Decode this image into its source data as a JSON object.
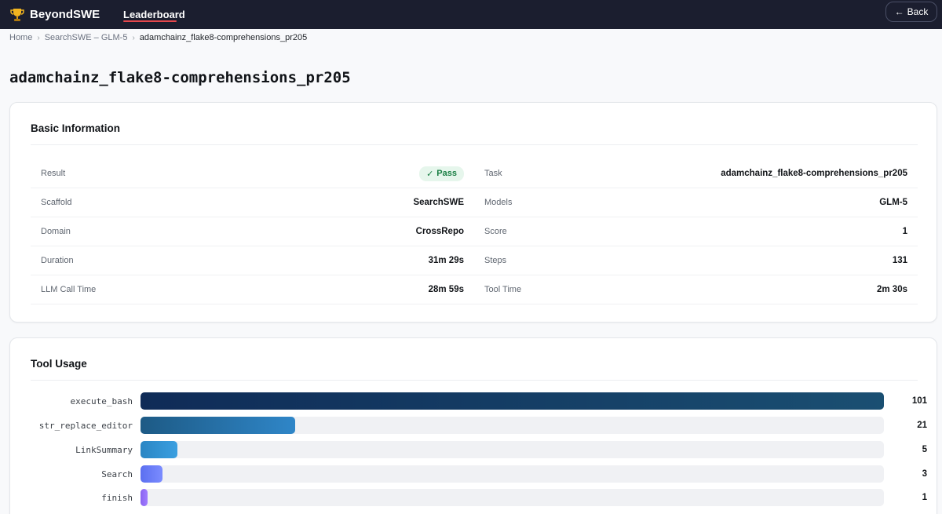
{
  "navbar": {
    "brand": "BeyondSWE",
    "nav_link": "Leaderboard",
    "back_label": "Back",
    "back_arrow": "←"
  },
  "breadcrumb": {
    "items": [
      "Home",
      "SearchSWE – GLM-5",
      "adamchainz_flake8-comprehensions_pr205"
    ],
    "separator": "›"
  },
  "page_title": "adamchainz_flake8-comprehensions_pr205",
  "basic_info": {
    "title": "Basic Information",
    "left": [
      {
        "label": "Result",
        "value": "Pass",
        "badge": true,
        "badge_icon": "✓"
      },
      {
        "label": "Scaffold",
        "value": "SearchSWE"
      },
      {
        "label": "Domain",
        "value": "CrossRepo"
      },
      {
        "label": "Duration",
        "value": "31m 29s"
      },
      {
        "label": "LLM Call Time",
        "value": "28m 59s"
      }
    ],
    "right": [
      {
        "label": "Task",
        "value": "adamchainz_flake8-comprehensions_pr205"
      },
      {
        "label": "Models",
        "value": "GLM-5"
      },
      {
        "label": "Score",
        "value": "1"
      },
      {
        "label": "Steps",
        "value": "131"
      },
      {
        "label": "Tool Time",
        "value": "2m 30s"
      }
    ]
  },
  "tool_usage": {
    "title": "Tool Usage",
    "max": 101,
    "tools": [
      {
        "name": "execute_bash",
        "count": 101,
        "color_start": "#0f2b57",
        "color_end": "#1a4f72"
      },
      {
        "name": "str_replace_editor",
        "count": 21,
        "color_start": "#1d5a85",
        "color_end": "#2f86c8"
      },
      {
        "name": "LinkSummary",
        "count": 5,
        "color_start": "#2a86c4",
        "color_end": "#3b9fe0"
      },
      {
        "name": "Search",
        "count": 3,
        "color_start": "#5b6ff0",
        "color_end": "#7b8cff"
      },
      {
        "name": "finish",
        "count": 1,
        "color_start": "#8a63f0",
        "color_end": "#a07cff"
      }
    ]
  }
}
